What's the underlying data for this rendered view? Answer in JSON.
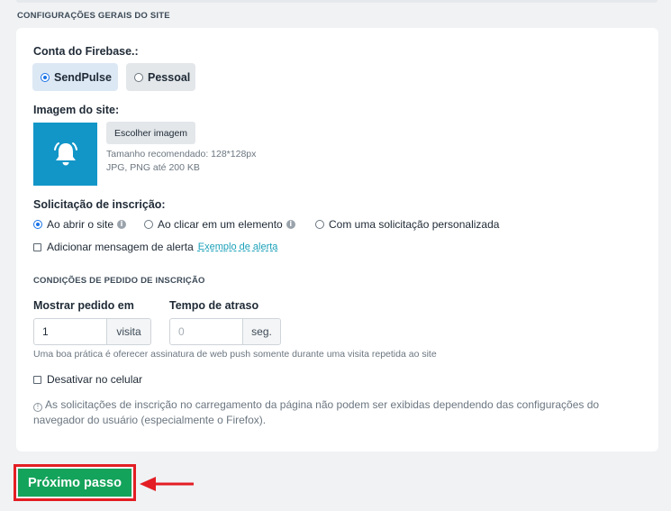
{
  "section_title": "CONFIGURAÇÕES GERAIS DO SITE",
  "firebase": {
    "label": "Conta do Firebase.:",
    "options": [
      {
        "label": "SendPulse",
        "selected": true
      },
      {
        "label": "Pessoal",
        "selected": false
      }
    ]
  },
  "site_image": {
    "label": "Imagem do site:",
    "icon": "bell-icon",
    "choose_button": "Escolher imagem",
    "hint_size": "Tamanho recomendado: 128*128px",
    "hint_format": "JPG, PNG até 200 KB"
  },
  "subscription": {
    "label": "Solicitação de inscrição:",
    "options": [
      {
        "label": "Ao abrir o site",
        "selected": true,
        "info": true
      },
      {
        "label": "Ao clicar em um elemento",
        "selected": false,
        "info": true
      },
      {
        "label": "Com uma solicitação personalizada",
        "selected": false,
        "info": false
      }
    ],
    "alert_checkbox": "Adicionar mensagem de alerta",
    "alert_checked": false,
    "alert_link": "Exemplo de alerta"
  },
  "conditions": {
    "title": "CONDIÇÕES DE PEDIDO DE INSCRIÇÃO",
    "show_label": "Mostrar pedido em",
    "show_value": "1",
    "show_unit": "visita",
    "delay_label": "Tempo de atraso",
    "delay_placeholder": "0",
    "delay_unit": "seg.",
    "hint": "Uma boa prática é oferecer assinatura de web push somente durante uma visita repetida ao site",
    "mobile_checkbox": "Desativar no celular",
    "mobile_checked": false,
    "notice": "As solicitações de inscrição no carregamento da página não podem ser exibidas dependendo das configurações do navegador do usuário (especialmente o Firefox)."
  },
  "next_button": "Próximo passo",
  "colors": {
    "accent_green": "#14a35b",
    "highlight_red": "#e31e24",
    "image_bg": "#1296c8",
    "link": "#1aa0b8"
  }
}
